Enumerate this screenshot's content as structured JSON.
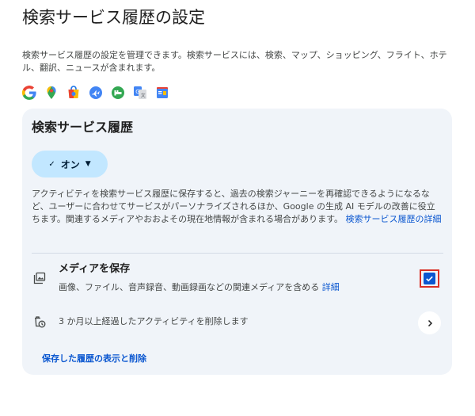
{
  "header": {
    "title": "検索サービス履歴の設定",
    "description": "検索サービス履歴の設定を管理できます。検索サービスには、検索、マップ、ショッピング、フライト、ホテル、翻訳、ニュースが含まれます。"
  },
  "service_icons": [
    "google-g-icon",
    "maps-pin-icon",
    "shopping-bag-icon",
    "flights-icon",
    "hotels-icon",
    "translate-icon",
    "news-icon"
  ],
  "card": {
    "title": "検索サービス履歴",
    "status_chip": {
      "check": "✓",
      "label": "オン",
      "caret": "▼"
    },
    "description": "アクティビティを検索サービス履歴に保存すると、過去の検索ジャーニーを再確認できるようになるなど、ユーザーに合わせてサービスがパーソナライズされるほか、Google の生成 AI モデルの改善に役立ちます。関連するメディアやおおよその現在地情報が含まれる場合があります。",
    "description_link": "検索サービス履歴の詳細",
    "media": {
      "title": "メディアを保存",
      "subtitle": "画像、ファイル、音声録音、動画録画などの関連メディアを含める",
      "link": "詳細",
      "checked": true
    },
    "auto_delete": {
      "text": "3 か月以上経過したアクティビティを削除します"
    },
    "history_link": "保存した履歴の表示と削除"
  },
  "colors": {
    "accent": "#0b57d0",
    "card_bg": "#f0f4f9",
    "chip_bg": "#c2e7ff",
    "highlight_border": "#d93025"
  }
}
